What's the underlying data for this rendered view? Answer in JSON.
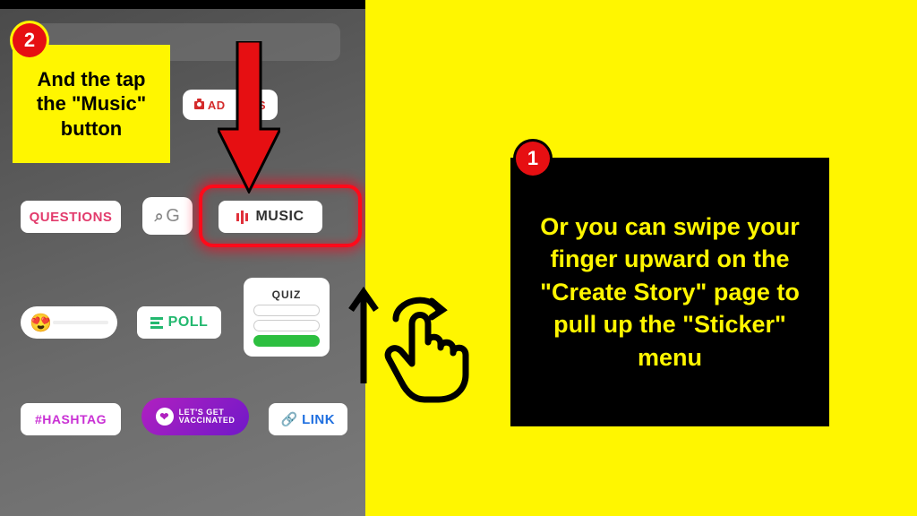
{
  "badges": {
    "one": "1",
    "two": "2"
  },
  "callouts": {
    "step1": "Or you can swipe your finger upward on the \"Create Story\" page to pull up the \"Sticker\" menu",
    "step2": "And the tap the \"Music\" button"
  },
  "stickers": {
    "add_yours": "AD    URS",
    "questions": "QUESTIONS",
    "search_letter": "G",
    "music": "MUSIC",
    "poll": "POLL",
    "quiz": "QUIZ",
    "hashtag": "#HASHTAG",
    "vaccinated_l1": "LET'S GET",
    "vaccinated_l2": "VACCINATED",
    "link": "LINK",
    "emoji": "😍"
  }
}
